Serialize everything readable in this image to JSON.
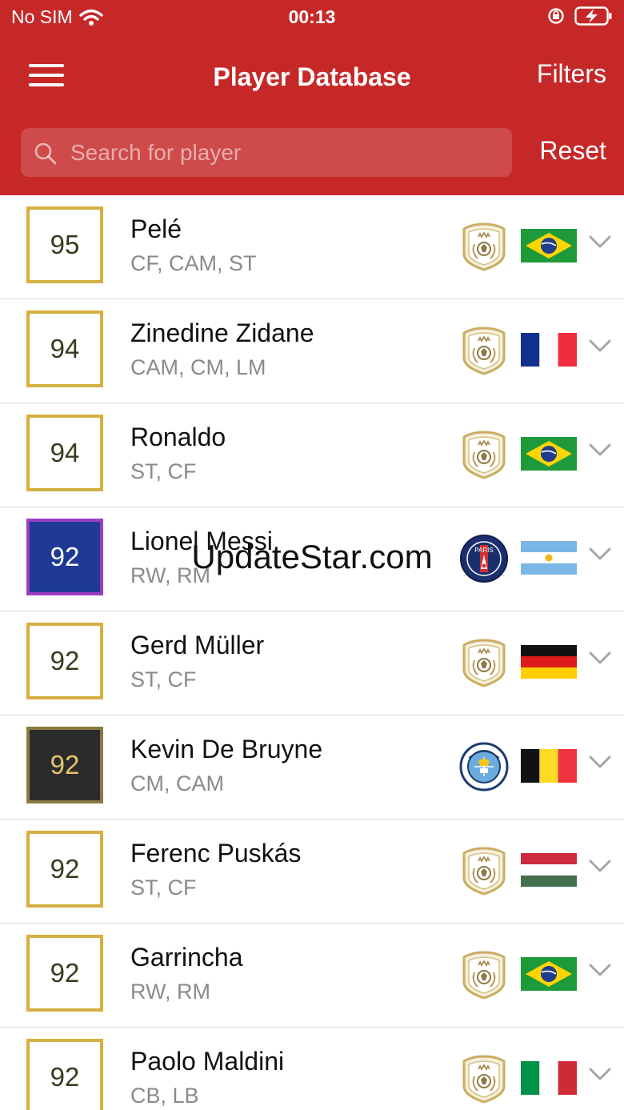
{
  "status": {
    "carrier": "No SIM",
    "time": "00:13"
  },
  "header": {
    "title": "Player Database",
    "filters_label": "Filters",
    "reset_label": "Reset"
  },
  "search": {
    "placeholder": "Search for player",
    "value": ""
  },
  "watermark": "UpdateStar.com",
  "colors": {
    "header": "#c62828",
    "gold_border": "#d4b042",
    "messi_card": "#1f3a94",
    "messi_border": "#9b3ec3",
    "kdb_card": "#2b2b2b"
  },
  "players": [
    {
      "rating": "95",
      "name": "Pelé",
      "positions": "CF, CAM, ST",
      "card": "gold",
      "club": "icon-badge",
      "flag": "brazil"
    },
    {
      "rating": "94",
      "name": "Zinedine Zidane",
      "positions": "CAM, CM, LM",
      "card": "gold",
      "club": "icon-badge",
      "flag": "france"
    },
    {
      "rating": "94",
      "name": "Ronaldo",
      "positions": "ST, CF",
      "card": "gold",
      "club": "icon-badge",
      "flag": "brazil"
    },
    {
      "rating": "92",
      "name": "Lionel Messi",
      "positions": "RW, RM",
      "card": "blue",
      "club": "psg-crest",
      "flag": "argentina"
    },
    {
      "rating": "92",
      "name": "Gerd Müller",
      "positions": "ST, CF",
      "card": "gold",
      "club": "icon-badge",
      "flag": "germany"
    },
    {
      "rating": "92",
      "name": "Kevin De Bruyne",
      "positions": "CM, CAM",
      "card": "dark",
      "club": "man-city-crest",
      "flag": "belgium"
    },
    {
      "rating": "92",
      "name": "Ferenc Puskás",
      "positions": "ST, CF",
      "card": "gold",
      "club": "icon-badge",
      "flag": "hungary"
    },
    {
      "rating": "92",
      "name": "Garrincha",
      "positions": "RW, RM",
      "card": "gold",
      "club": "icon-badge",
      "flag": "brazil"
    },
    {
      "rating": "92",
      "name": "Paolo Maldini",
      "positions": "CB, LB",
      "card": "gold",
      "club": "icon-badge",
      "flag": "italy"
    }
  ]
}
